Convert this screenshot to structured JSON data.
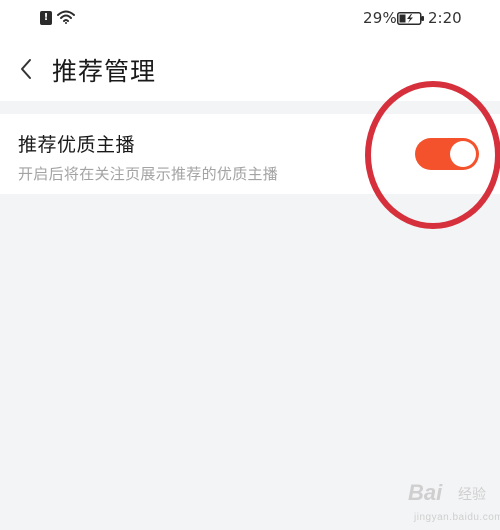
{
  "status_bar": {
    "alert_icon": "sim-alert-icon",
    "alert_glyph": "!",
    "wifi_icon": "wifi-icon",
    "battery_percent": "29%",
    "battery_icon": "battery-charging-icon",
    "time": "2:20"
  },
  "header": {
    "back_icon": "chevron-left-icon",
    "title": "推荐管理"
  },
  "setting": {
    "title": "推荐优质主播",
    "description": "开启后将在关注页展示推荐的优质主播",
    "enabled": true,
    "toggle_color": "#f4522d"
  },
  "annotation": {
    "ring_color": "#d5303c"
  },
  "watermark": {
    "brand": "Bai",
    "suffix": "经验",
    "url": "jingyan.baidu.com"
  }
}
